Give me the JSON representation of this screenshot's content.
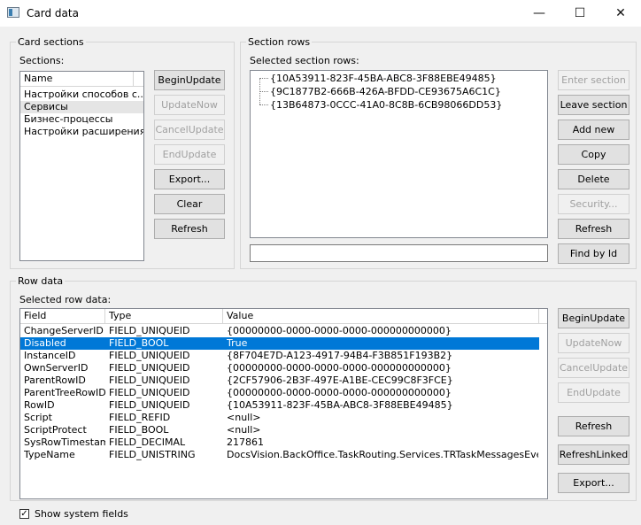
{
  "window": {
    "title": "Card data",
    "minimize": "—",
    "maximize": "☐",
    "close": "✕"
  },
  "card_sections": {
    "title": "Card sections",
    "sections_label": "Sections:",
    "column_name": "Name",
    "items": [
      "Настройки способов с...",
      "Сервисы",
      "Бизнес-процессы",
      "Настройки расширения"
    ],
    "buttons": [
      "BeginUpdate",
      "UpdateNow",
      "CancelUpdate",
      "EndUpdate",
      "Export...",
      "Clear",
      "Refresh"
    ]
  },
  "section_rows": {
    "title": "Section rows",
    "selected_label": "Selected section rows:",
    "rows": [
      "{10A53911-823F-45BA-ABC8-3F88EBE49485}",
      "{9C1877B2-666B-426A-BFDD-CE93675A6C1C}",
      "{13B64873-0CCC-41A0-8C8B-6CB98066DD53}"
    ],
    "input_value": "",
    "buttons": [
      "Enter section",
      "Leave section",
      "Add new",
      "Copy",
      "Delete",
      "Security...",
      "Refresh",
      "Find by Id"
    ]
  },
  "row_data": {
    "title": "Row data",
    "selected_label": "Selected row data:",
    "columns": [
      "Field",
      "Type",
      "Value"
    ],
    "rows": [
      [
        "ChangeServerID",
        "FIELD_UNIQUEID",
        "{00000000-0000-0000-0000-000000000000}"
      ],
      [
        "Disabled",
        "FIELD_BOOL",
        "True"
      ],
      [
        "InstanceID",
        "FIELD_UNIQUEID",
        "{8F704E7D-A123-4917-94B4-F3B851F193B2}"
      ],
      [
        "OwnServerID",
        "FIELD_UNIQUEID",
        "{00000000-0000-0000-0000-000000000000}"
      ],
      [
        "ParentRowID",
        "FIELD_UNIQUEID",
        "{2CF57906-2B3F-497E-A1BE-CEC99C8F3FCE}"
      ],
      [
        "ParentTreeRowID",
        "FIELD_UNIQUEID",
        "{00000000-0000-0000-0000-000000000000}"
      ],
      [
        "RowID",
        "FIELD_UNIQUEID",
        "{10A53911-823F-45BA-ABC8-3F88EBE49485}"
      ],
      [
        "Script",
        "FIELD_REFID",
        "<null>"
      ],
      [
        "ScriptProtect",
        "FIELD_BOOL",
        "<null>"
      ],
      [
        "SysRowTimestamp",
        "FIELD_DECIMAL",
        "217861"
      ],
      [
        "TypeName",
        "FIELD_UNISTRING",
        "DocsVision.BackOffice.TaskRouting.Services.TRTaskMessagesEvent..."
      ]
    ],
    "buttons": [
      "BeginUpdate",
      "UpdateNow",
      "CancelUpdate",
      "EndUpdate",
      "Refresh",
      "RefreshLinked",
      "Export..."
    ]
  },
  "show_system_fields": {
    "label": "Show system fields",
    "checked": true,
    "mark": "✓"
  }
}
